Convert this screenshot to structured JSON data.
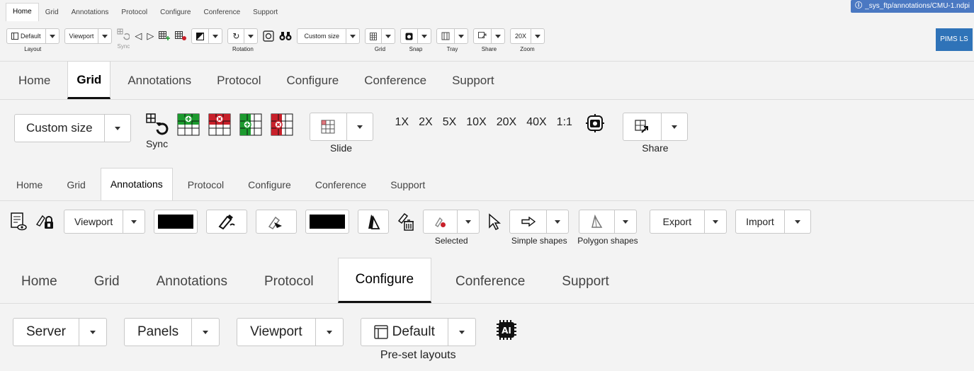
{
  "s1": {
    "tabs": [
      "Home",
      "Grid",
      "Annotations",
      "Protocol",
      "Configure",
      "Conference",
      "Support"
    ],
    "path": "_sys_ftp/annotations/CMU-1.ndpi",
    "pims": "PIMS LS",
    "layout_value": "Default",
    "layout_label": "Layout",
    "viewport": "Viewport",
    "sync_label": "Sync",
    "rotation_label": "Rotation",
    "custom_size": "Custom size",
    "grid_label": "Grid",
    "snap_label": "Snap",
    "tray_label": "Tray",
    "share_label": "Share",
    "zoom_value": "20X",
    "zoom_label": "Zoom"
  },
  "s2": {
    "tabs": [
      "Home",
      "Grid",
      "Annotations",
      "Protocol",
      "Configure",
      "Conference",
      "Support"
    ],
    "custom_size": "Custom size",
    "sync_label": "Sync",
    "slide_label": "Slide",
    "zooms": [
      "1X",
      "2X",
      "5X",
      "10X",
      "20X",
      "40X",
      "1:1"
    ],
    "share_label": "Share"
  },
  "s3": {
    "tabs": [
      "Home",
      "Grid",
      "Annotations",
      "Protocol",
      "Configure",
      "Conference",
      "Support"
    ],
    "viewport": "Viewport",
    "selected_label": "Selected",
    "simple_shapes_label": "Simple shapes",
    "polygon_shapes_label": "Polygon shapes",
    "export": "Export",
    "import": "Import"
  },
  "s4": {
    "tabs": [
      "Home",
      "Grid",
      "Annotations",
      "Protocol",
      "Configure",
      "Conference",
      "Support"
    ],
    "server": "Server",
    "panels": "Panels",
    "viewport": "Viewport",
    "default": "Default",
    "preset_label": "Pre-set layouts",
    "ai": "AI"
  },
  "colors": {
    "accent": "#2f73b8",
    "grid_green": "#1c9a2e",
    "grid_red": "#c8202a"
  }
}
